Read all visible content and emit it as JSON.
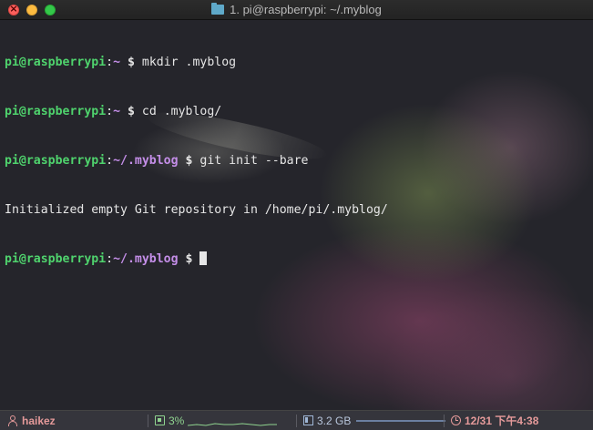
{
  "window": {
    "title": "1. pi@raspberrypi: ~/.myblog"
  },
  "terminal": {
    "lines": [
      {
        "user": "pi@raspberrypi",
        "colon": ":",
        "path": "~",
        "dollar": " $ ",
        "cmd": "mkdir .myblog"
      },
      {
        "user": "pi@raspberrypi",
        "colon": ":",
        "path": "~",
        "dollar": " $ ",
        "cmd": "cd .myblog/"
      },
      {
        "user": "pi@raspberrypi",
        "colon": ":",
        "path": "~/.myblog",
        "dollar": " $ ",
        "cmd": "git init --bare"
      },
      {
        "output": "Initialized empty Git repository in /home/pi/.myblog/"
      },
      {
        "user": "pi@raspberrypi",
        "colon": ":",
        "path": "~/.myblog",
        "dollar": " $ ",
        "cmd": ""
      }
    ]
  },
  "statusbar": {
    "user": "haikez",
    "cpu": "3%",
    "memory": "3.2 GB",
    "datetime": "12/31 下午4:38"
  },
  "colors": {
    "prompt_user": "#4fd36d",
    "prompt_path": "#c48ee8",
    "text": "#e6e6e6",
    "statusbar_bg": "#35353c"
  },
  "icons": {
    "titlebar": "folder-icon",
    "user": "user-icon",
    "cpu": "cpu-icon",
    "memory": "memory-icon",
    "clock": "clock-icon"
  }
}
